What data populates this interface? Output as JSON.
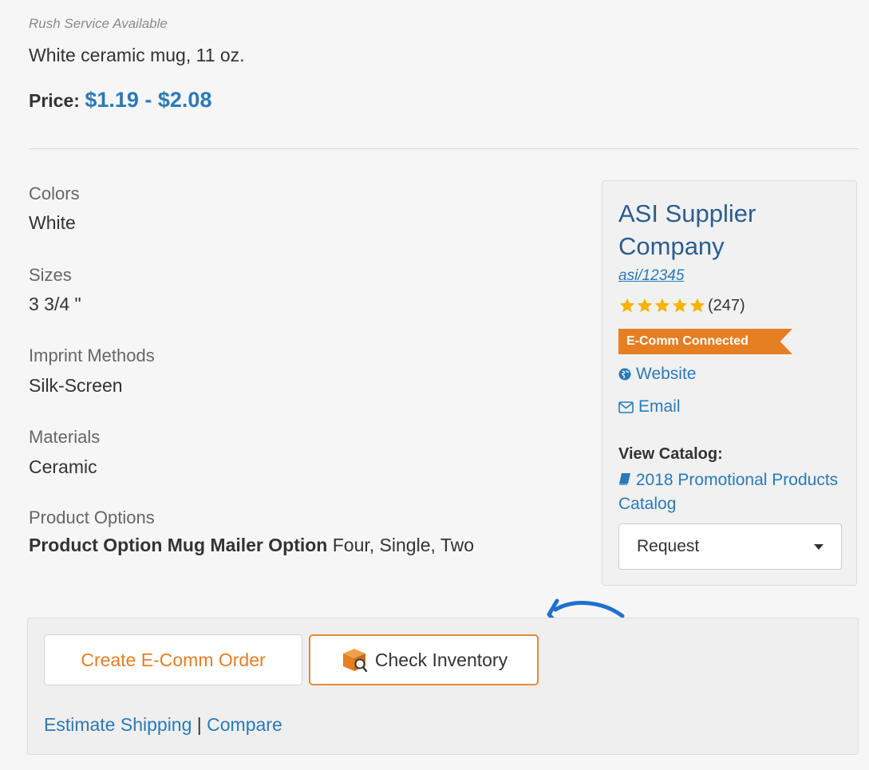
{
  "product": {
    "rush": "Rush Service Available",
    "description": "White ceramic mug, 11 oz.",
    "price_label": "Price:",
    "price_value": "$1.19 - $2.08"
  },
  "attributes": [
    {
      "label": "Colors",
      "value": "White"
    },
    {
      "label": "Sizes",
      "value": "3 3/4 \""
    },
    {
      "label": "Imprint Methods",
      "value": "Silk-Screen"
    },
    {
      "label": "Materials",
      "value": "Ceramic"
    },
    {
      "label": "Product Options"
    }
  ],
  "product_options": {
    "name": "Product Option Mug Mailer Option",
    "values": "Four, Single, Two"
  },
  "supplier": {
    "name": "ASI Supplier Company",
    "asi": "asi/12345",
    "rating": 5,
    "review_count": "(247)",
    "badge": "E-Comm Connected",
    "website": "Website",
    "email": "Email",
    "view_catalog": "View Catalog:",
    "catalog_name": "2018 Promotional Products Catalog",
    "request_option": "Request"
  },
  "actions": {
    "ecomm_order": "Create E-Comm Order",
    "check_inventory": "Check Inventory",
    "estimate_shipping": "Estimate Shipping",
    "separator": "|",
    "compare": "Compare"
  },
  "colors": {
    "link": "#2a7ab8",
    "accent_orange": "#e67e22",
    "star": "#f5b400",
    "arrow": "#1f6fd1"
  },
  "icons": {
    "website": "globe-icon",
    "email": "envelope-icon",
    "catalog": "book-icon",
    "inventory": "box-icon",
    "request": "chevron-down-icon"
  }
}
